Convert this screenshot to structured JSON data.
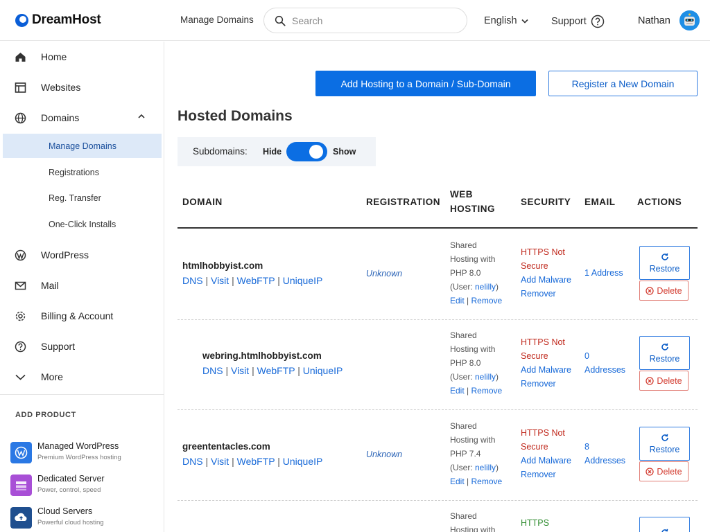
{
  "brand": {
    "name": "DreamHost",
    "accent": "#0b6ee3"
  },
  "header": {
    "manage_domains": "Manage Domains",
    "search_placeholder": "Search",
    "language": "English",
    "support": "Support",
    "user": "Nathan"
  },
  "sidebar": {
    "items": [
      {
        "label": "Home",
        "icon": "home-icon"
      },
      {
        "label": "Websites",
        "icon": "websites-icon"
      },
      {
        "label": "Domains",
        "icon": "globe-icon"
      },
      {
        "label": "WordPress",
        "icon": "wordpress-icon"
      },
      {
        "label": "Mail",
        "icon": "mail-icon"
      },
      {
        "label": "Billing & Account",
        "icon": "gear-icon"
      },
      {
        "label": "Support",
        "icon": "help-icon"
      },
      {
        "label": "More",
        "icon": "chevron-down-icon"
      }
    ],
    "domain_subitems": [
      {
        "label": "Manage Domains",
        "active": true
      },
      {
        "label": "Registrations"
      },
      {
        "label": "Reg. Transfer"
      },
      {
        "label": "One-Click Installs"
      }
    ],
    "add_product_heading": "ADD PRODUCT",
    "products": [
      {
        "name": "Managed WordPress",
        "desc": "Premium WordPress hosting",
        "color": "#2a78e4"
      },
      {
        "name": "Dedicated Server",
        "desc": "Power, control, speed",
        "color": "#a84fd6"
      },
      {
        "name": "Cloud Servers",
        "desc": "Powerful cloud hosting",
        "color": "#1f4f8f"
      }
    ]
  },
  "main": {
    "add_hosting_button": "Add Hosting to a Domain / Sub-Domain",
    "register_button": "Register a New Domain",
    "title": "Hosted Domains",
    "subdomains": {
      "label": "Subdomains:",
      "hide": "Hide",
      "show": "Show",
      "enabled": true
    },
    "columns": {
      "domain": "DOMAIN",
      "registration": "REGISTRATION",
      "web_hosting_1": "WEB",
      "web_hosting_2": "HOSTING",
      "security": "SECURITY",
      "email": "EMAIL",
      "actions": "ACTIONS"
    },
    "links": {
      "dns": "DNS",
      "visit": "Visit",
      "webftp": "WebFTP",
      "uniqueip": "UniqueIP",
      "edit": "Edit",
      "remove": "Remove",
      "restore": "Restore",
      "delete": "Delete",
      "sep": "|"
    },
    "rows": [
      {
        "domain": "htmlhobbyist.com",
        "registration": "Unknown",
        "hosting_1": "Shared",
        "hosting_2": "Hosting with",
        "hosting_3": "PHP 8.0",
        "user_prefix": "(User: ",
        "user": "nelilly",
        "user_suffix": ")",
        "security_1": "HTTPS Not",
        "security_2": "Secure",
        "security_link_1": "Add Malware",
        "security_link_2": "Remover",
        "email_1": "1 Address",
        "email_2": ""
      },
      {
        "domain": "webring.htmlhobbyist.com",
        "registration": "",
        "hosting_1": "Shared",
        "hosting_2": "Hosting with",
        "hosting_3": "PHP 8.0",
        "user_prefix": "(User: ",
        "user": "nelilly",
        "user_suffix": ")",
        "security_1": "HTTPS Not",
        "security_2": "Secure",
        "security_link_1": "Add Malware",
        "security_link_2": "Remover",
        "email_1": "0",
        "email_2": "Addresses"
      },
      {
        "domain": "greententacles.com",
        "registration": "Unknown",
        "hosting_1": "Shared",
        "hosting_2": "Hosting with",
        "hosting_3": "PHP 7.4",
        "user_prefix": "(User: ",
        "user": "nelilly",
        "user_suffix": ")",
        "security_1": "HTTPS Not",
        "security_2": "Secure",
        "security_link_1": "Add Malware",
        "security_link_2": "Remover",
        "email_1": "8",
        "email_2": "Addresses"
      },
      {
        "hosting_1": "Shared",
        "hosting_2": "Hosting with",
        "security_1": "HTTPS"
      }
    ]
  }
}
